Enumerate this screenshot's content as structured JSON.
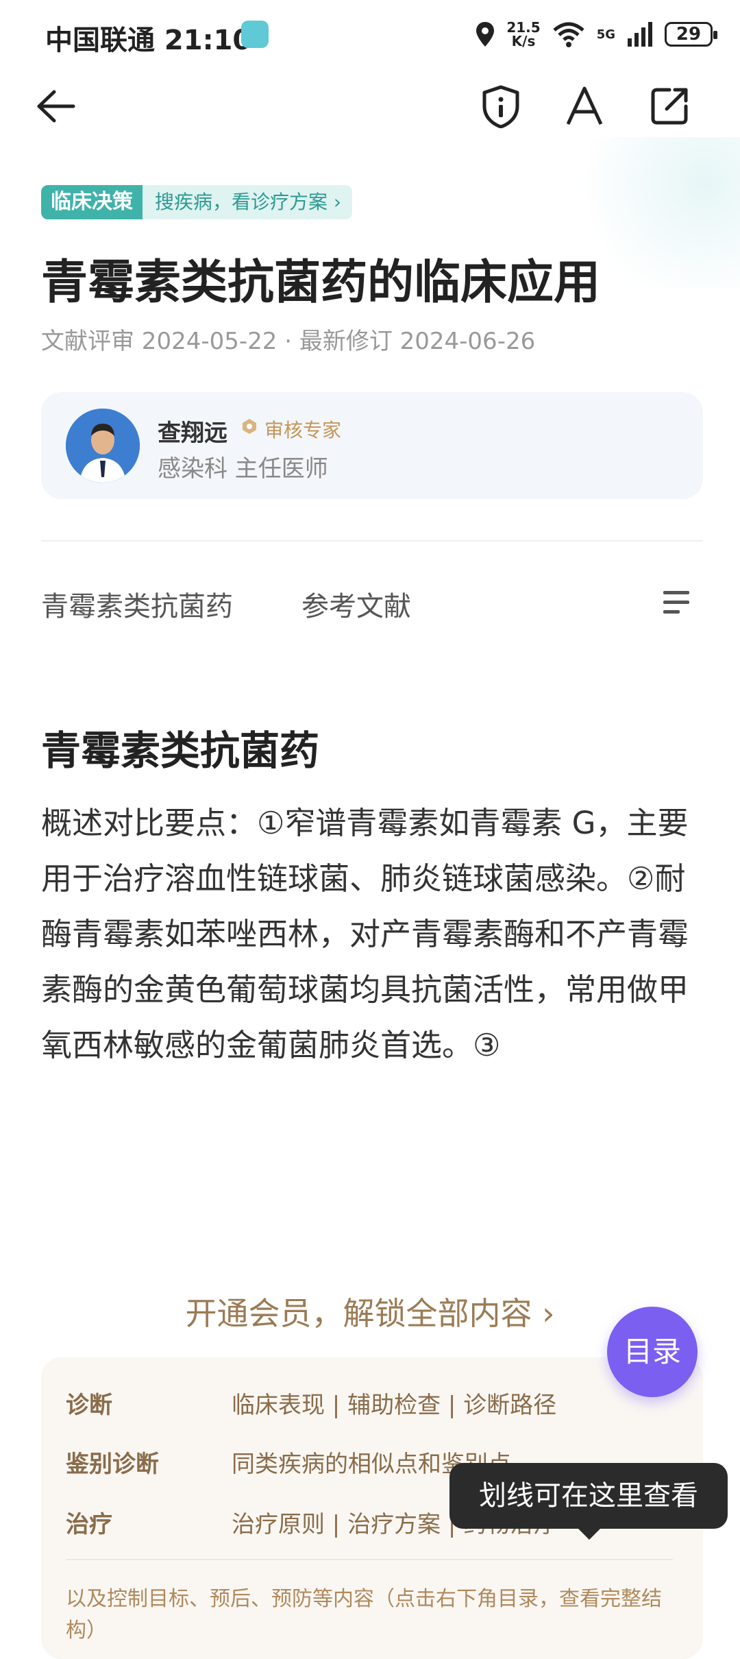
{
  "status_bar": {
    "carrier_time": "中国联通 21:10",
    "net_speed_top": "21.5",
    "net_speed_bottom": "K/s",
    "wifi_badge": "6",
    "cell_type": "5G",
    "battery": "29"
  },
  "nav": {
    "back_icon": "arrow-left-icon",
    "shield_icon": "shield-info-icon",
    "font_icon": "font-size-icon",
    "share_icon": "share-icon"
  },
  "tag": {
    "label": "临床决策",
    "link": "搜疾病，看诊疗方案 ›"
  },
  "article": {
    "title": "青霉素类抗菌药的临床应用",
    "meta": "文献评审 2024-05-22 · 最新修订 2024-06-26"
  },
  "author": {
    "name": "查翔远",
    "badge": "审核专家",
    "dept": "感染科 主任医师"
  },
  "tabs": [
    {
      "label": "青霉素类抗菌药"
    },
    {
      "label": "参考文献"
    }
  ],
  "section": {
    "title": "青霉素类抗菌药",
    "body": "概述对比要点：①窄谱青霉素如青霉素 G，主要用于治疗溶血性链球菌、肺炎链球菌感染。②耐酶青霉素如苯唑西林，对产青霉素酶和不产青霉素酶的金黄色葡萄球菌均具抗菌活性，常用做甲氧西林敏感的金葡菌肺炎首选。③"
  },
  "paywall": {
    "unlock_text": "开通会员，解锁全部内容 ›",
    "rows": [
      {
        "label": "诊断",
        "value": "临床表现 | 辅助检查 | 诊断路径"
      },
      {
        "label": "鉴别诊断",
        "value": "同类疾病的相似点和鉴别点"
      },
      {
        "label": "治疗",
        "value": "治疗原则 | 治疗方案 | 药物治疗"
      }
    ],
    "footer": "以及控制目标、预后、预防等内容（点击右下角目录，查看完整结构）"
  },
  "toc_button": "目录",
  "tooltip": "划线可在这里查看",
  "colors": {
    "accent_teal": "#3fb3aa",
    "gold": "#9b7b55",
    "purple": "#7b5ff0"
  }
}
